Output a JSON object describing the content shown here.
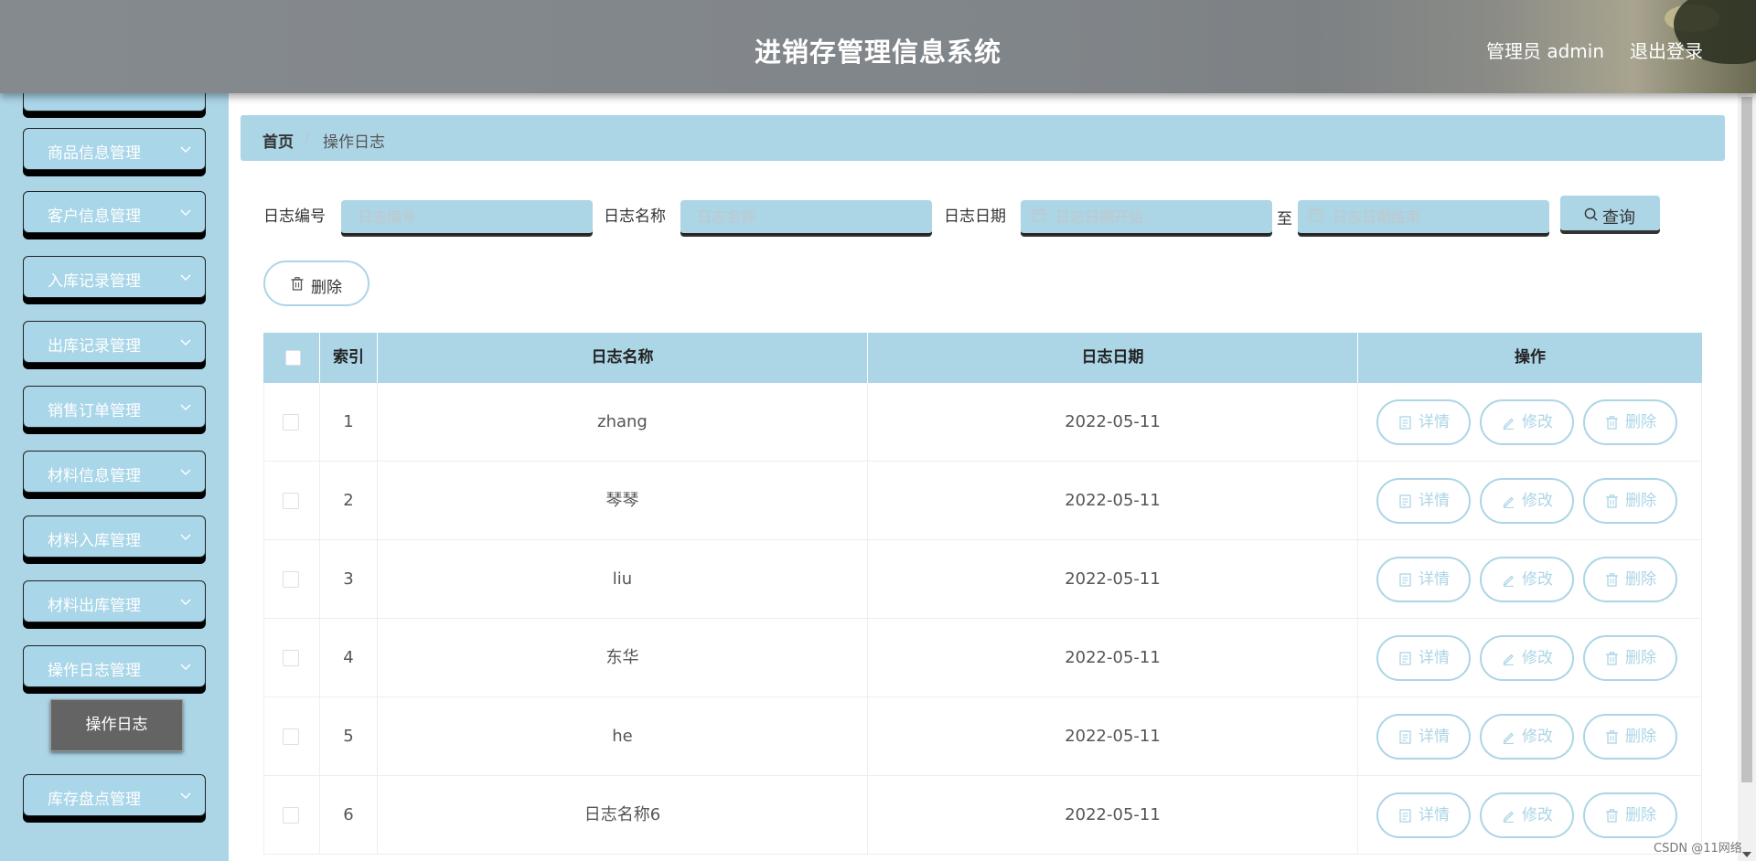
{
  "header": {
    "title": "进销存管理信息系统",
    "user_label": "管理员 admin",
    "logout_label": "退出登录"
  },
  "sidebar": {
    "items": [
      {
        "label": "商品信息管理"
      },
      {
        "label": "客户信息管理"
      },
      {
        "label": "入库记录管理"
      },
      {
        "label": "出库记录管理"
      },
      {
        "label": "销售订单管理"
      },
      {
        "label": "材料信息管理"
      },
      {
        "label": "材料入库管理"
      },
      {
        "label": "材料出库管理"
      },
      {
        "label": "操作日志管理"
      },
      {
        "label": "库存盘点管理"
      }
    ],
    "active_sub": "操作日志"
  },
  "breadcrumb": {
    "home": "首页",
    "separator": "/",
    "current": "操作日志"
  },
  "filters": {
    "log_no_label": "日志编号",
    "log_no_placeholder": "日志编号",
    "log_name_label": "日志名称",
    "log_name_placeholder": "日志名称",
    "log_date_label": "日志日期",
    "date_start_placeholder": "日志日期开始",
    "to_label": "至",
    "date_end_placeholder": "日志日期结束",
    "query_label": "查询"
  },
  "actions": {
    "delete_label": "删除"
  },
  "table": {
    "columns": [
      "索引",
      "日志名称",
      "日志日期",
      "操作"
    ],
    "rows": [
      {
        "index": "1",
        "name": "zhang",
        "date": "2022-05-11"
      },
      {
        "index": "2",
        "name": "琴琴",
        "date": "2022-05-11"
      },
      {
        "index": "3",
        "name": "liu",
        "date": "2022-05-11"
      },
      {
        "index": "4",
        "name": "东华",
        "date": "2022-05-11"
      },
      {
        "index": "5",
        "name": "he",
        "date": "2022-05-11"
      },
      {
        "index": "6",
        "name": "日志名称6",
        "date": "2022-05-11"
      }
    ],
    "row_actions": {
      "detail": "详情",
      "edit": "修改",
      "delete": "删除"
    }
  },
  "watermark": "CSDN @11网络",
  "colors": {
    "accent": "#acd5e6",
    "header_bg": "#858a8f",
    "submenu_bg": "#646464"
  }
}
